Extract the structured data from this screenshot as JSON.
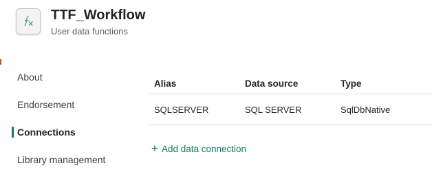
{
  "header": {
    "title": "TTF_Workflow",
    "subtitle": "User data functions",
    "icon": "function-fx-icon"
  },
  "sidebar": {
    "items": [
      {
        "label": "About",
        "active": false
      },
      {
        "label": "Endorsement",
        "active": false
      },
      {
        "label": "Connections",
        "active": true
      },
      {
        "label": "Library management",
        "active": false
      }
    ]
  },
  "connections": {
    "columns": [
      "Alias",
      "Data source",
      "Type"
    ],
    "rows": [
      {
        "alias": "SQLSERVER",
        "data_source": "SQL SERVER",
        "type": "SqlDbNative"
      }
    ],
    "add_icon": "+",
    "add_label": "Add data connection"
  },
  "colors": {
    "accent": "#117865",
    "text": "#242424",
    "muted": "#616161",
    "divider": "#e0e0e0"
  }
}
